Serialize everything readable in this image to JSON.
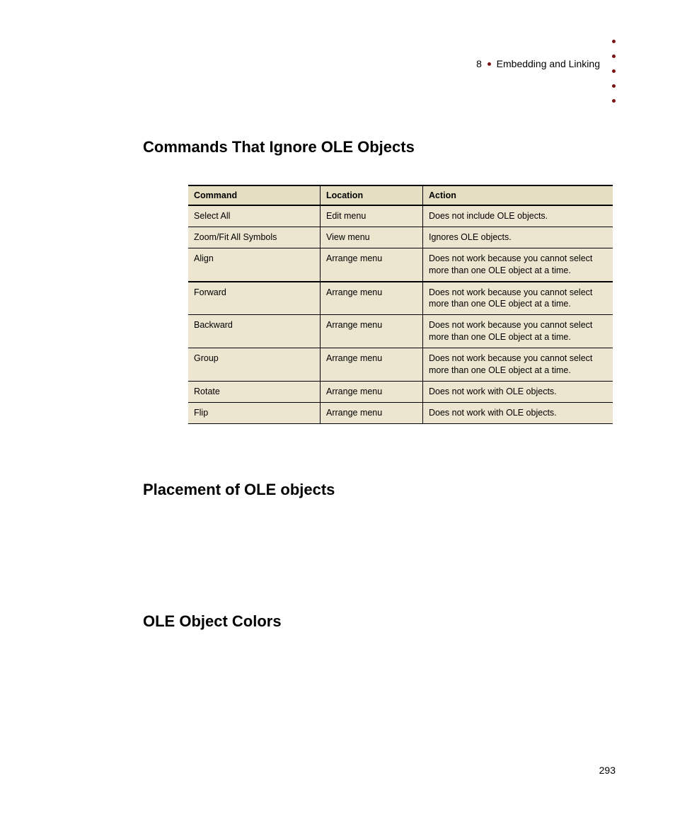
{
  "header": {
    "chapter_number": "8",
    "chapter_title": "Embedding and Linking"
  },
  "section1_title": "Commands That Ignore OLE Objects",
  "section2_title": "Placement of OLE objects",
  "section3_title": "OLE Object Colors",
  "table": {
    "headers": {
      "c1": "Command",
      "c2": "Location",
      "c3": "Action"
    },
    "rows": [
      {
        "command": "Select All",
        "location": "Edit menu",
        "action": "Does not include OLE objects."
      },
      {
        "command": "Zoom/Fit All Symbols",
        "location": "View menu",
        "action": "Ignores OLE objects."
      },
      {
        "command": "Align",
        "location": "Arrange menu",
        "action": "Does not work because you cannot select more than one OLE object at a time."
      },
      {
        "command": "Forward",
        "location": "Arrange menu",
        "action": "Does not work because you cannot select more than one OLE object at a time."
      },
      {
        "command": "Backward",
        "location": "Arrange menu",
        "action": "Does not work because you cannot select more than one OLE object at a time."
      },
      {
        "command": "Group",
        "location": "Arrange menu",
        "action": "Does not work because you cannot select more than one OLE object at a time."
      },
      {
        "command": "Rotate",
        "location": "Arrange menu",
        "action": "Does not work with OLE objects."
      },
      {
        "command": "Flip",
        "location": "Arrange menu",
        "action": "Does not work with OLE objects."
      }
    ]
  },
  "page_number": "293"
}
